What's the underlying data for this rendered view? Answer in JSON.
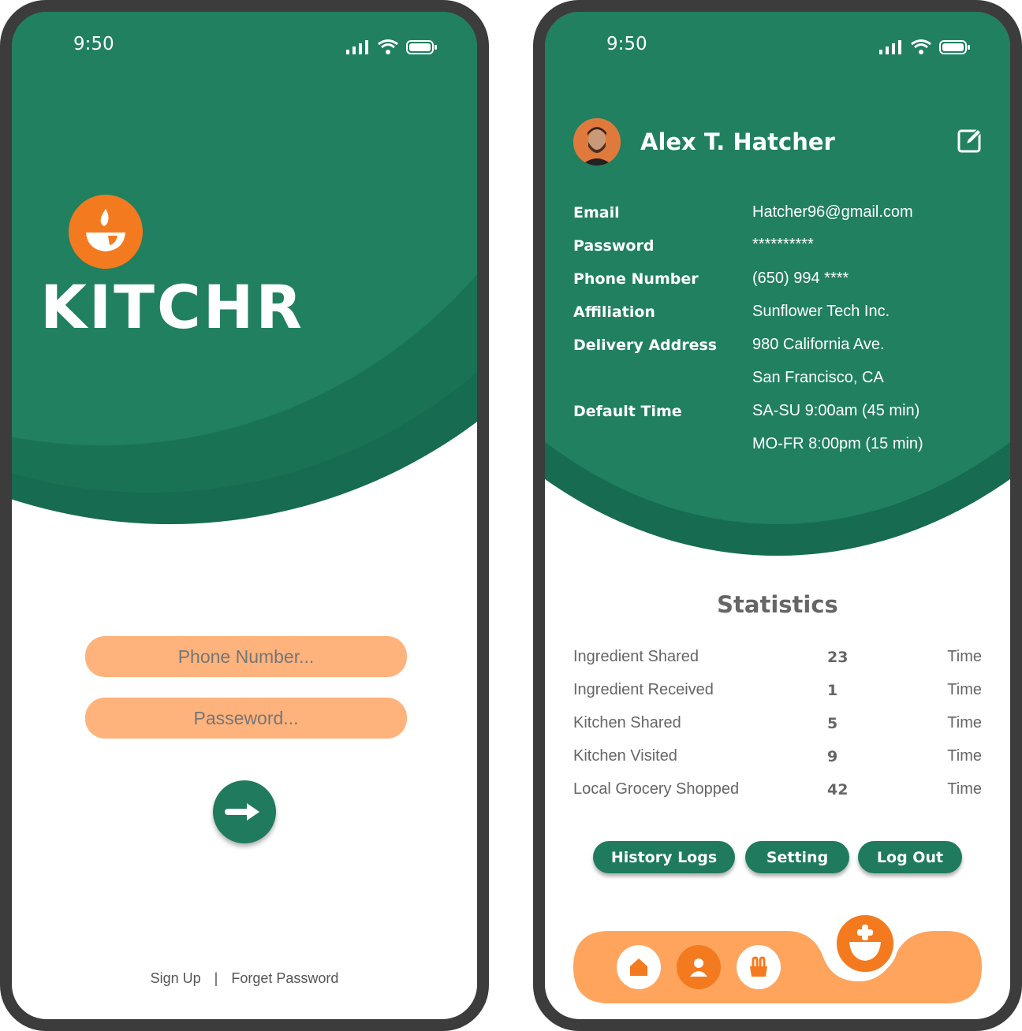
{
  "login": {
    "status_time": "9:50",
    "brand": "KITCHR",
    "phone_placeholder": "Phone Number...",
    "password_placeholder": "Passeword...",
    "signup_link": "Sign Up",
    "separator": "|",
    "forget_link": "Forget Password"
  },
  "profile": {
    "status_time": "9:50",
    "name": "Alex T. Hatcher",
    "fields": [
      {
        "label": "Email",
        "value": "Hatcher96@gmail.com"
      },
      {
        "label": "Password",
        "value": "**********"
      },
      {
        "label": "Phone Number",
        "value": "(650) 994 ****"
      },
      {
        "label": "Affiliation",
        "value": "Sunflower Tech Inc."
      },
      {
        "label": "Delivery Address",
        "value": "980 California Ave."
      },
      {
        "label": "",
        "value": "San Francisco, CA"
      },
      {
        "label": "Default Time",
        "value": "SA-SU  9:00am (45 min)"
      },
      {
        "label": "",
        "value": "MO-FR  8:00pm (15 min)"
      }
    ],
    "stats_title": "Statistics",
    "stats": [
      {
        "label": "Ingredient Shared",
        "value": "23",
        "unit": "Time"
      },
      {
        "label": "Ingredient Received",
        "value": "1",
        "unit": "Time"
      },
      {
        "label": "Kitchen Shared",
        "value": "5",
        "unit": "Time"
      },
      {
        "label": "Kitchen Visited",
        "value": "9",
        "unit": "Time"
      },
      {
        "label": "Local Grocery Shopped",
        "value": "42",
        "unit": "Time"
      }
    ],
    "buttons": {
      "history": "History Logs",
      "setting": "Setting",
      "logout": "Log Out"
    },
    "nav_icons": [
      "home-icon",
      "profile-icon",
      "basket-icon",
      "add-bowl-icon"
    ]
  },
  "colors": {
    "primary_green": "#1f7a5e",
    "dark_green": "#166b50",
    "orange": "#f47a1f",
    "light_orange": "#ffb37c",
    "nav_orange": "#ffa45c"
  }
}
